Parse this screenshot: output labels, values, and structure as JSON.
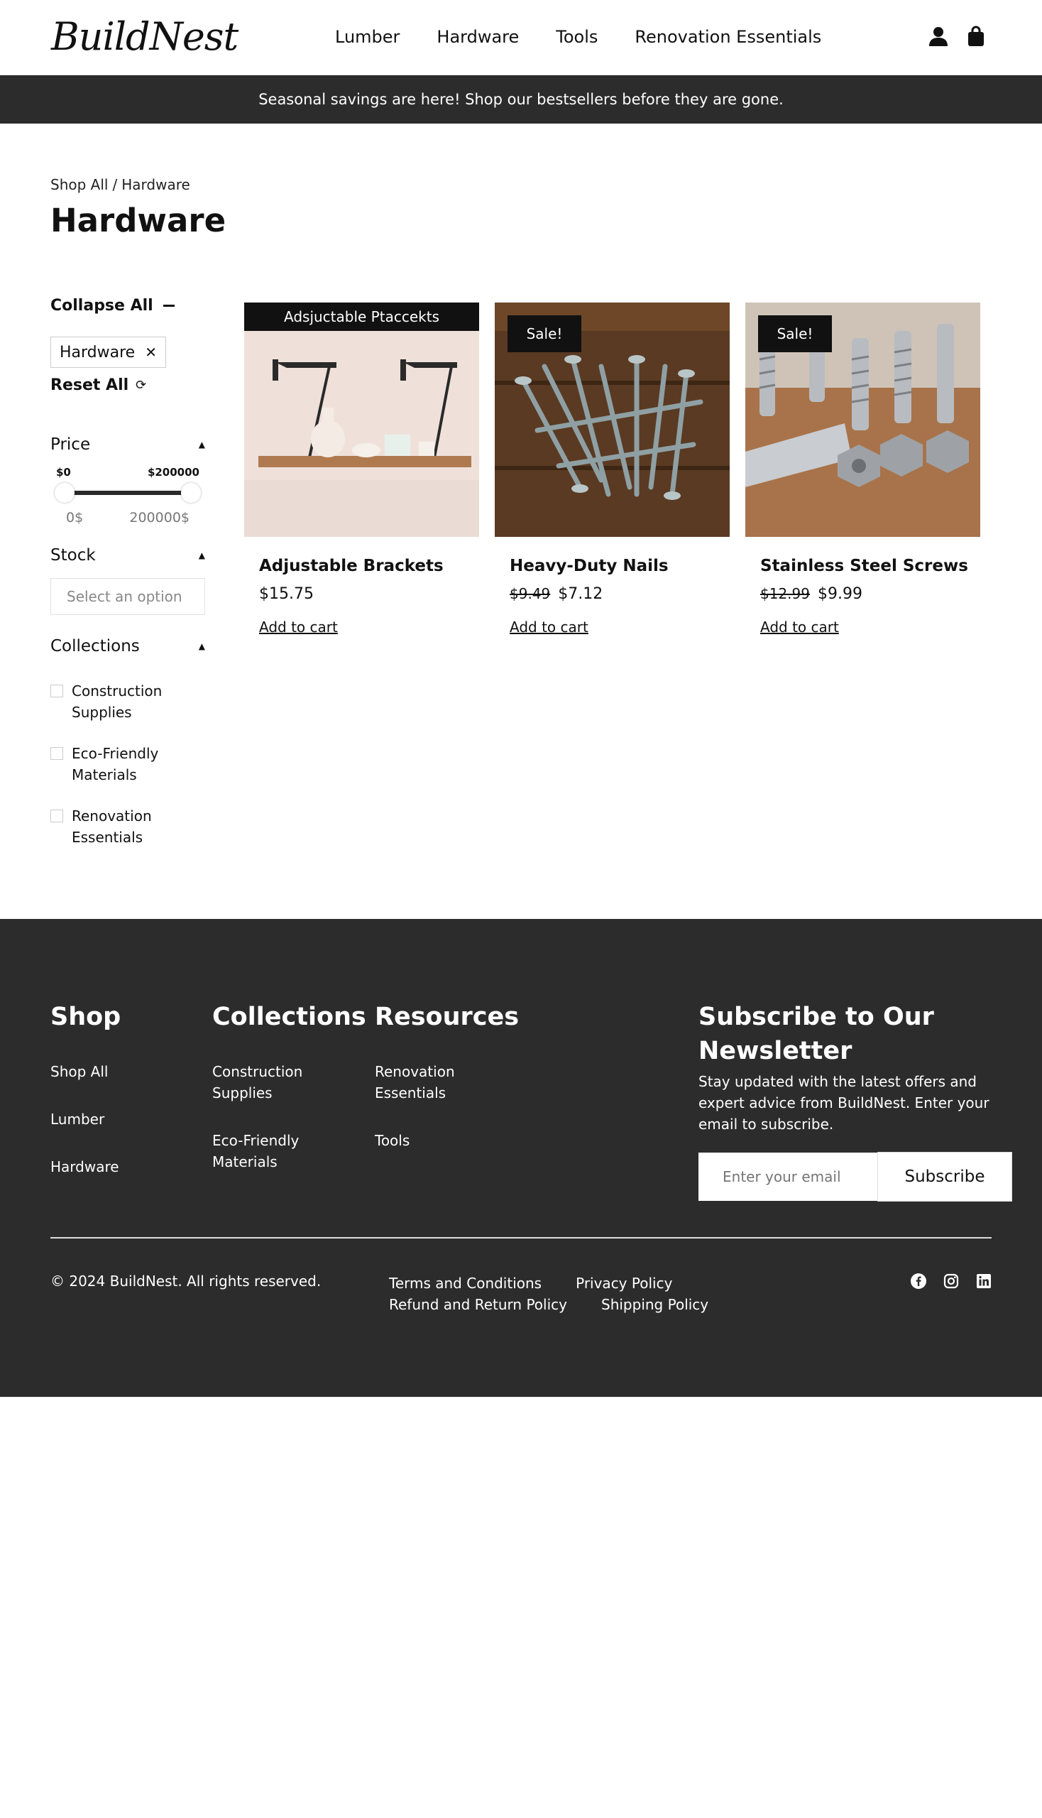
{
  "brand": {
    "logo": "BuildNest"
  },
  "nav": {
    "items": [
      "Lumber",
      "Hardware",
      "Tools",
      "Renovation Essentials"
    ]
  },
  "announcement": "Seasonal savings are here! Shop our bestsellers before they are gone.",
  "breadcrumb": {
    "root": "Shop All",
    "sep": "/",
    "current": "Hardware"
  },
  "page_title": "Hardware",
  "sidebar": {
    "collapse_all": "Collapse All",
    "active_filter": "Hardware",
    "reset_all": "Reset All",
    "price": {
      "label": "Price",
      "min_label": "$0",
      "max_label": "$200000",
      "min_value": "0$",
      "max_value": "200000$"
    },
    "stock": {
      "label": "Stock",
      "placeholder": "Select an option"
    },
    "collections": {
      "label": "Collections",
      "items": [
        "Construction Supplies",
        "Eco-Friendly Materials",
        "Renovation Essentials"
      ]
    }
  },
  "products": [
    {
      "name": "Adjustable Brackets",
      "price": "$15.75",
      "old_price": "",
      "badge": "",
      "image_title": "Adsjuctable Ptaccekts",
      "cta": "Add to cart"
    },
    {
      "name": "Heavy-Duty Nails",
      "price": "$7.12",
      "old_price": "$9.49",
      "badge": "Sale!",
      "cta": "Add to cart"
    },
    {
      "name": "Stainless Steel Screws",
      "price": "$9.99",
      "old_price": "$12.99",
      "badge": "Sale!",
      "cta": "Add to cart"
    }
  ],
  "footer": {
    "shop": {
      "title": "Shop",
      "links": [
        "Shop All",
        "Lumber",
        "Hardware"
      ]
    },
    "collections": {
      "title": "Collections",
      "links": [
        "Construction Supplies",
        "Eco-Friendly Materials"
      ]
    },
    "resources": {
      "title": "Resources",
      "links": [
        "Renovation Essentials",
        "Tools"
      ]
    },
    "newsletter": {
      "title": "Subscribe to Our Newsletter",
      "text": "Stay updated with the latest offers and expert advice from BuildNest. Enter your email to subscribe.",
      "placeholder": "Enter your email",
      "button": "Subscribe"
    },
    "copyright": "© 2024 BuildNest. All rights reserved.",
    "legal": [
      "Terms and Conditions",
      "Privacy Policy",
      "Refund and Return Policy",
      "Shipping Policy"
    ],
    "socials": [
      "facebook-icon",
      "instagram-icon",
      "linkedin-icon"
    ]
  }
}
